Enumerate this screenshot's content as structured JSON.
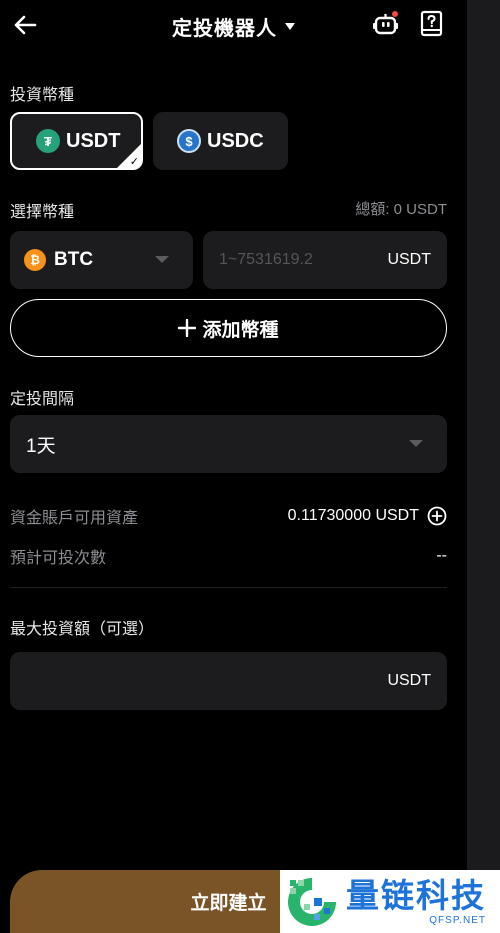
{
  "header": {
    "title": "定投機器人",
    "back_icon": "arrow-left-icon",
    "robot_icon": "robot-icon",
    "guide_icon": "help-book-icon"
  },
  "currency_section": {
    "label": "投資幣種",
    "options": [
      {
        "symbol": "USDT",
        "color": "#26a17b",
        "selected": true
      },
      {
        "symbol": "USDC",
        "color": "#2775ca",
        "selected": false
      }
    ]
  },
  "coin_section": {
    "label": "選擇幣種",
    "total_label": "總額: 0 USDT",
    "selected_coin": "BTC",
    "coin_color": "#f7931a",
    "amount_placeholder": "1~7531619.2",
    "amount_unit": "USDT",
    "add_button": "添加幣種"
  },
  "interval_section": {
    "label": "定投間隔",
    "value": "1天"
  },
  "balances": {
    "available_label": "資金賬戶可用資產",
    "available_value": "0.11730000 USDT",
    "estimate_label": "預計可投次數",
    "estimate_value": "--"
  },
  "max_section": {
    "label": "最大投資額（可選）",
    "unit": "USDT"
  },
  "footer": {
    "confirm_label": "立即建立"
  },
  "watermark": {
    "title": "量链科技",
    "subtitle": "QFSP.NET"
  },
  "colors": {
    "accent_button": "#7a5427",
    "card_bg": "#1c1c1e",
    "watermark_blue": "#1e73d8"
  }
}
